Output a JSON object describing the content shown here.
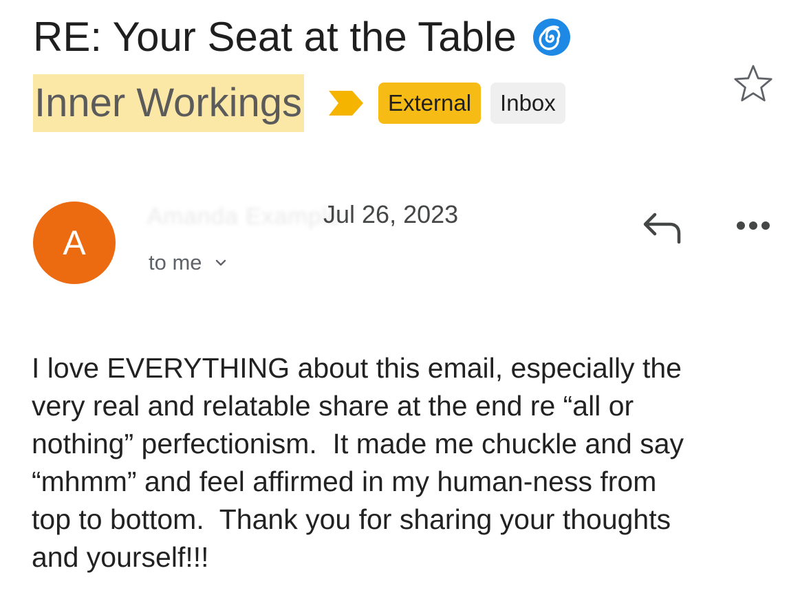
{
  "email": {
    "subject": "RE: Your Seat at the Table",
    "subject_emoji_icon": "cyclone-emoji-icon",
    "label_name": "Inner Workings",
    "label_highlight_color": "#fbe7a6",
    "chips": {
      "external": "External",
      "inbox": "Inbox"
    },
    "external_chip_color": "#f7bb16",
    "importance_marker_color": "#f4b400",
    "sender": {
      "avatar_initial": "A",
      "avatar_color": "#ec6a10",
      "name_redacted": "Amanda Example"
    },
    "date": "Jul 26, 2023",
    "recipient": "to me",
    "body": "I love EVERYTHING about this email, especially the\nvery real and relatable share at the end re “all or\nnothing” perfectionism.  It made me chuckle and say\n“mhmm” and feel affirmed in my human-ness from\ntop to bottom.  Thank you for sharing your thoughts\nand yourself!!!"
  },
  "icons": {
    "star": "star-outline-icon",
    "reply": "reply-icon",
    "more": "more-horizontal-icon",
    "chevron": "chevron-down-icon",
    "importance": "importance-marker-icon"
  }
}
